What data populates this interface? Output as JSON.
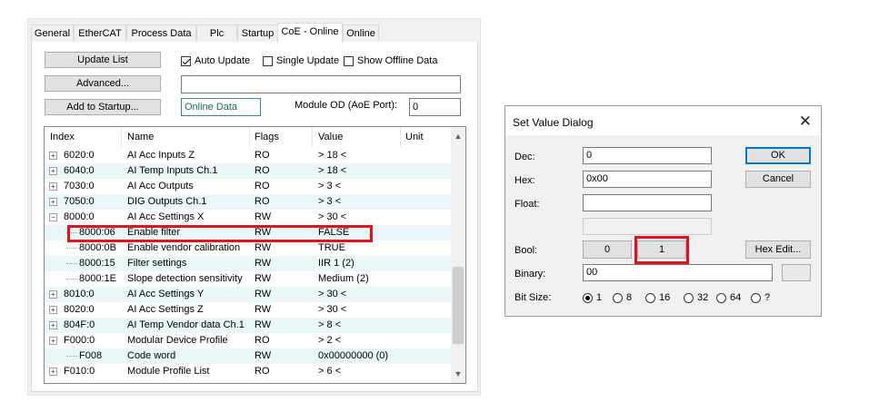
{
  "tabs": [
    "General",
    "EtherCAT",
    "Process Data",
    "Plc",
    "Startup",
    "CoE - Online",
    "Online"
  ],
  "active_tab": "CoE - Online",
  "buttons": {
    "update_list": "Update List",
    "advanced": "Advanced...",
    "add_to_startup": "Add to Startup..."
  },
  "checks": {
    "auto_update": "Auto Update",
    "single_update": "Single Update",
    "show_offline": "Show Offline Data"
  },
  "online_data": "Online Data",
  "module_od_label": "Module OD (AoE Port):",
  "module_od_value": "0",
  "columns": [
    "Index",
    "Name",
    "Flags",
    "Value",
    "Unit"
  ],
  "rows": [
    {
      "index": "6020:0",
      "name": "AI Acc Inputs Z",
      "flags": "RO",
      "value": "> 18 <",
      "expander": "+"
    },
    {
      "index": "6040:0",
      "name": "AI Temp Inputs Ch.1",
      "flags": "RO",
      "value": "> 18 <",
      "expander": "+"
    },
    {
      "index": "7030:0",
      "name": "AI Acc Outputs",
      "flags": "RO",
      "value": "> 3 <",
      "expander": "+"
    },
    {
      "index": "7050:0",
      "name": "DIG Outputs Ch.1",
      "flags": "RO",
      "value": "> 3 <",
      "expander": "+"
    },
    {
      "index": "8000:0",
      "name": "AI Acc Settings X",
      "flags": "RW",
      "value": "> 30 <",
      "expander": "−"
    },
    {
      "index": "8000:06",
      "name": "Enable filter",
      "flags": "RW",
      "value": "FALSE",
      "expander": ""
    },
    {
      "index": "8000:0B",
      "name": "Enable vendor calibration",
      "flags": "RW",
      "value": "TRUE",
      "expander": ""
    },
    {
      "index": "8000:15",
      "name": "Filter settings",
      "flags": "RW",
      "value": "IIR 1 (2)",
      "expander": ""
    },
    {
      "index": "8000:1E",
      "name": "Slope detection sensitivity",
      "flags": "RW",
      "value": "Medium (2)",
      "expander": ""
    },
    {
      "index": "8010:0",
      "name": "AI Acc Settings Y",
      "flags": "RW",
      "value": "> 30 <",
      "expander": "+"
    },
    {
      "index": "8020:0",
      "name": "AI Acc Settings Z",
      "flags": "RW",
      "value": "> 30 <",
      "expander": "+"
    },
    {
      "index": "804F:0",
      "name": "AI Temp Vendor data Ch.1",
      "flags": "RW",
      "value": "> 8 <",
      "expander": "+"
    },
    {
      "index": "F000:0",
      "name": "Modular Device Profile",
      "flags": "RO",
      "value": "> 2 <",
      "expander": "+"
    },
    {
      "index": "F008",
      "name": "Code word",
      "flags": "RW",
      "value": "0x00000000 (0)",
      "expander": ""
    },
    {
      "index": "F010:0",
      "name": "Module Profile List",
      "flags": "RO",
      "value": "> 6 <",
      "expander": "+"
    }
  ],
  "dialog": {
    "title": "Set Value Dialog",
    "dec_label": "Dec:",
    "dec_value": "0",
    "hex_label": "Hex:",
    "hex_value": "0x00",
    "float_label": "Float:",
    "float_value": "",
    "bool_label": "Bool:",
    "bool_false": "0",
    "bool_true": "1",
    "binary_label": "Binary:",
    "binary_value": "00",
    "bitsize_label": "Bit Size:",
    "bitsizes": [
      "1",
      "8",
      "16",
      "32",
      "64",
      "?"
    ],
    "selected_bitsize": "1",
    "ok": "OK",
    "cancel": "Cancel",
    "hex_edit": "Hex Edit..."
  },
  "highlight_color": "#e4131b",
  "alt_row_color": "#eaf7f8"
}
